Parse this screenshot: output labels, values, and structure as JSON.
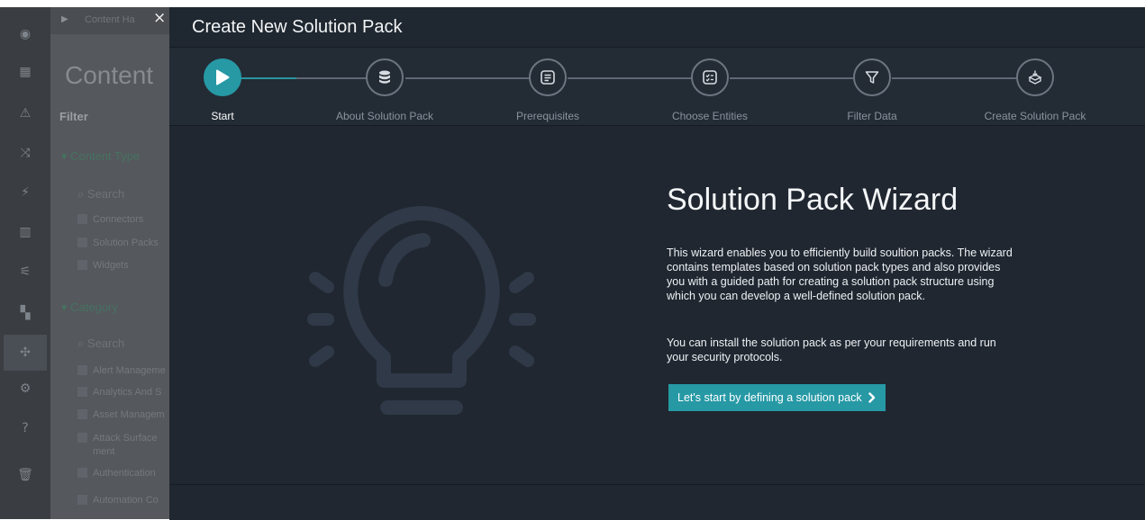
{
  "background": {
    "page_heading_partial": "Content",
    "breadcrumb_partial": "Content Ha",
    "filter_label": "Filter",
    "content_type_section": "Content Type",
    "search_placeholder": "Search",
    "content_type_options": [
      "Connectors",
      "Solution Packs",
      "Widgets"
    ],
    "category_section": "Category",
    "category_options": [
      "Alert Manageme",
      "Analytics And S",
      "Asset Managem",
      "Attack Surface",
      "ment",
      "Authentication",
      "Automation Co"
    ]
  },
  "modal": {
    "title": "Create New Solution Pack",
    "close_glyph": "×",
    "steps": [
      {
        "label": "Start",
        "icon": "play-icon",
        "active": true
      },
      {
        "label": "About Solution Pack",
        "icon": "database-icon",
        "active": false
      },
      {
        "label": "Prerequisites",
        "icon": "list-icon",
        "active": false
      },
      {
        "label": "Choose Entities",
        "icon": "checklist-icon",
        "active": false
      },
      {
        "label": "Filter Data",
        "icon": "filter-icon",
        "active": false
      },
      {
        "label": "Create Solution Pack",
        "icon": "package-icon",
        "active": false
      }
    ],
    "wizard": {
      "heading": "Solution Pack Wizard",
      "paragraph1": "This wizard enables you to efficiently build soultion packs. The wizard contains templates based on solution pack types and also provides you with a guided path for creating a solution pack structure using which you can develop a well-defined solution pack.",
      "paragraph2": "You can install the solution pack as per your requirements and run your security protocols.",
      "start_button": "Let's start by defining a solution pack",
      "start_button_icon": "chevron-right-icon"
    }
  },
  "colors": {
    "accent": "#2699a5",
    "modal_bg": "#202731",
    "stepper_bg": "#232b35"
  }
}
